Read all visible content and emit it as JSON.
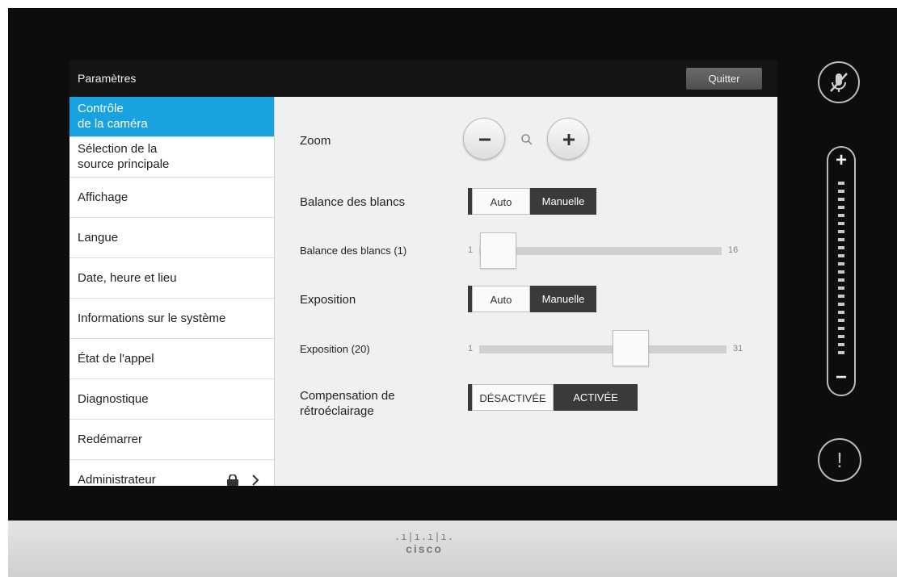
{
  "window": {
    "title": "Paramètres",
    "quit_label": "Quitter"
  },
  "sidebar": {
    "items": [
      {
        "line1": "Contrôle",
        "line2": "de la caméra",
        "active": true
      },
      {
        "line1": "Sélection de la",
        "line2": "source principale"
      },
      {
        "label": "Affichage"
      },
      {
        "label": "Langue"
      },
      {
        "label": "Date, heure et lieu"
      },
      {
        "label": "Informations sur le système"
      },
      {
        "label": "État de l'appel"
      },
      {
        "label": "Diagnostique"
      },
      {
        "label": "Redémarrer"
      },
      {
        "label": "Administrateur",
        "icons": [
          "lock-icon",
          "chevron-right-icon"
        ]
      }
    ]
  },
  "camera": {
    "zoom_label": "Zoom",
    "white_balance": {
      "label": "Balance des blancs",
      "options": [
        "Auto",
        "Manuelle"
      ],
      "selected": "Manuelle"
    },
    "white_balance_slider": {
      "label": "Balance des blancs (1)",
      "min": "1",
      "max": "16",
      "value": 1
    },
    "exposure": {
      "label": "Exposition",
      "options": [
        "Auto",
        "Manuelle"
      ],
      "selected": "Manuelle"
    },
    "exposure_slider": {
      "label": "Exposition (20)",
      "min": "1",
      "max": "31",
      "value": 20
    },
    "backlight": {
      "label_line1": "Compensation de",
      "label_line2": "rétroéclairage",
      "options": [
        "DÉSACTIVÉE",
        "ACTIVÉE"
      ],
      "selected": "ACTIVÉE"
    }
  },
  "hardware": {
    "brand": "cisco",
    "brand_bars": ".ı|ı.ı|ı.",
    "mic_state": "muted",
    "volume_plus": "+",
    "volume_minus": "−",
    "alert_symbol": "!"
  },
  "colors": {
    "accent": "#18a2e0",
    "toggle_active": "#3a3a3a",
    "bezel": "#0d0d0d"
  }
}
